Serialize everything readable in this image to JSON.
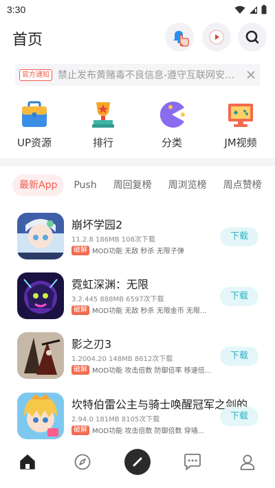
{
  "status_bar": {
    "time": "3:30",
    "icons": [
      "wifi-icon",
      "signal-icon",
      "battery-icon"
    ]
  },
  "header": {
    "title": "首页",
    "buttons": [
      "notification-bell-icon",
      "video-play-icon",
      "search-icon"
    ]
  },
  "notice": {
    "tag": "官方通知",
    "text": "禁止发布黄赌毒不良信息-遵守互联网安全..."
  },
  "quick_nav": [
    {
      "label": "UP资源",
      "icon": "toolbox-icon"
    },
    {
      "label": "排行",
      "icon": "trophy-icon"
    },
    {
      "label": "分类",
      "icon": "pacman-icon"
    },
    {
      "label": "JM视频",
      "icon": "game-screen-icon"
    }
  ],
  "tabs": [
    {
      "label": "最新App",
      "active": true
    },
    {
      "label": "Push",
      "active": false
    },
    {
      "label": "周回复榜",
      "active": false
    },
    {
      "label": "周浏览榜",
      "active": false
    },
    {
      "label": "周点赞榜",
      "active": false
    }
  ],
  "apps": [
    {
      "name": "崩坏学园2",
      "meta": "11.2.8 186MB 108次下载",
      "badge": "破解",
      "tags": "MOD功能 无敌 秒杀 无限子弹",
      "download": "下载"
    },
    {
      "name": "霓虹深渊：无限",
      "meta": "3.2.445 888MB 6597次下载",
      "badge": "破解",
      "tags": "MOD功能 无敌 秒杀 无限金币 无限...",
      "download": "下载"
    },
    {
      "name": "影之刃3",
      "meta": "1.2004.20 148MB 8612次下载",
      "badge": "破解",
      "tags": "MOD功能 攻击倍数 防御倍率 移速倍...",
      "download": "下载"
    },
    {
      "name": "坎特伯雷公主与骑士唤醒冠军之剑的",
      "meta": "2.94.0 181MB 8105次下载",
      "badge": "破解",
      "tags": "MOD功能 攻击倍数 防御倍数 穿墙...",
      "download": "下载"
    }
  ],
  "bottom_nav": [
    "home-icon",
    "compass-icon",
    "pen-icon",
    "chat-icon",
    "profile-icon"
  ],
  "colors": {
    "accent": "#f25c4f",
    "download_text": "#2bb3c4",
    "download_bg": "#e4f6f8"
  }
}
